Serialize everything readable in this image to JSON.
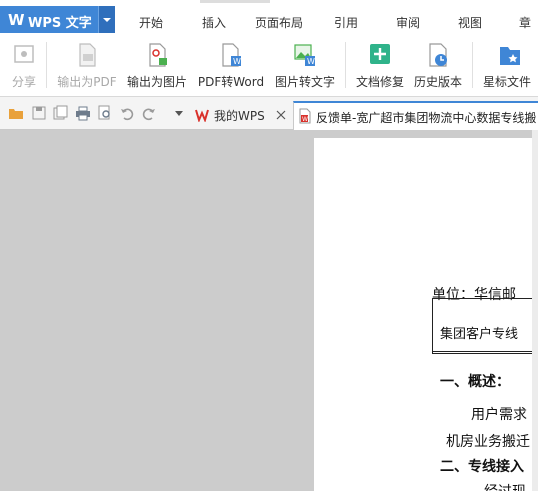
{
  "app": {
    "title": "WPS 文字"
  },
  "menu": {
    "tabs": [
      "开始",
      "插入",
      "页面布局",
      "引用",
      "审阅",
      "视图",
      "章"
    ]
  },
  "ribbon": {
    "buttons": [
      "分享",
      "输出为PDF",
      "输出为图片",
      "PDF转Word",
      "图片转文字",
      "文档修复",
      "历史版本",
      "星标文件"
    ]
  },
  "doc_tabs": {
    "home": "我的WPS",
    "active": "反馈单-宽广超市集团物流中心数据专线搬"
  },
  "document": {
    "unit_line": "单位：华信邮",
    "table_cell": "集团客户专线",
    "h1": "一、概述：",
    "p1": "用户需求",
    "p2": "机房业务搬迁",
    "h2": "二、专线接入",
    "p3": "经过现"
  },
  "colors": {
    "accent": "#3f86d6",
    "wps_red": "#d9312b"
  }
}
